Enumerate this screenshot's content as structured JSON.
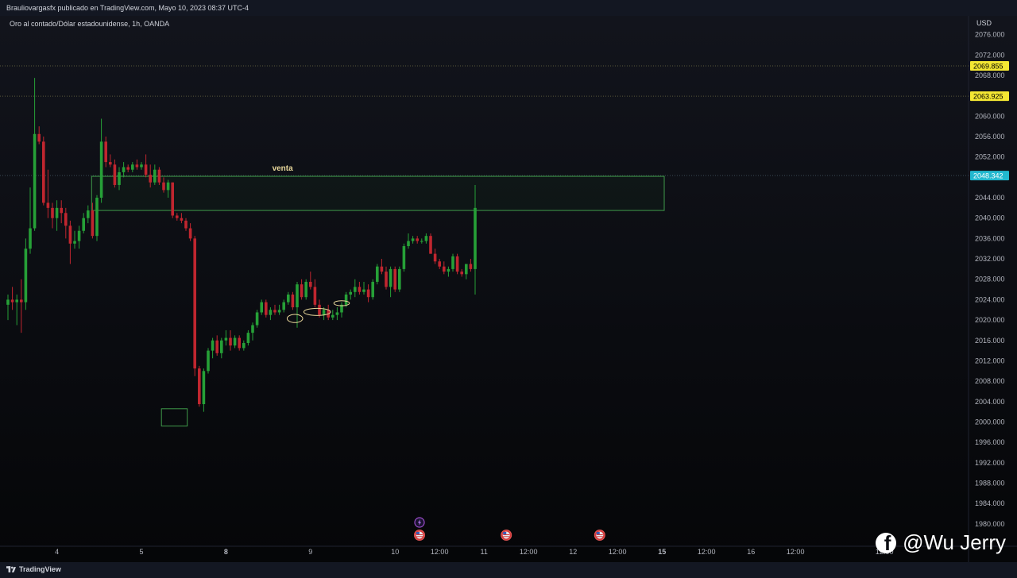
{
  "header": {
    "publisher_line": "Brauliovargasfx publicado en TradingView.com, Mayo 10, 2023 08:37 UTC-4",
    "symbol_line": "Oro al contado/Dólar estadounidense, 1h, OANDA"
  },
  "footer": {
    "brand": "TradingView"
  },
  "watermark": {
    "text": "@Wu Jerry",
    "icon": "facebook-icon"
  },
  "colors": {
    "background": "#0b0d12",
    "bull": "#26a037",
    "bear": "#c0262f",
    "zone": "#3f9a4a",
    "annotation": "#e8d79a",
    "price_tag_yellow": "#f4e733",
    "price_tag_cyan": "#22b8cf"
  },
  "chart_data": {
    "type": "candlestick",
    "title": "",
    "currency": "USD",
    "ylim": [
      1978,
      2080
    ],
    "y_ticks": [
      "2076.000",
      "2072.000",
      "2068.000",
      "2064.000",
      "2060.000",
      "2056.000",
      "2052.000",
      "2048.000",
      "2044.000",
      "2040.000",
      "2036.000",
      "2032.000",
      "2028.000",
      "2024.000",
      "2020.000",
      "2016.000",
      "2012.000",
      "2008.000",
      "2004.000",
      "2000.000",
      "1996.000",
      "1992.000",
      "1988.000",
      "1984.000",
      "1980.000"
    ],
    "x_labels": [
      {
        "label": "4",
        "bar": 11
      },
      {
        "label": "5",
        "bar": 30
      },
      {
        "label": "8",
        "bar": 49
      },
      {
        "label": "9",
        "bar": 68
      },
      {
        "label": "10",
        "bar": 87
      },
      {
        "label": "12:00",
        "bar": 97
      },
      {
        "label": "11",
        "bar": 107
      },
      {
        "label": "12:00",
        "bar": 117
      },
      {
        "label": "12",
        "bar": 127
      },
      {
        "label": "12:00",
        "bar": 137
      },
      {
        "label": "15",
        "bar": 147
      },
      {
        "label": "12:00",
        "bar": 157
      },
      {
        "label": "16",
        "bar": 167
      },
      {
        "label": "12:00",
        "bar": 177
      },
      {
        "label": "12:00",
        "bar": 197
      }
    ],
    "x_bold_labels": [
      "8",
      "15"
    ],
    "x_bar_count": 210,
    "candles": [
      [
        2023.0,
        2025.0,
        2020.0,
        2024.0
      ],
      [
        2024.0,
        2026.5,
        2022.0,
        2023.5
      ],
      [
        2023.5,
        2025.0,
        2019.0,
        2024.0
      ],
      [
        2024.0,
        2028.0,
        2017.5,
        2023.5
      ],
      [
        2023.5,
        2036.0,
        2022.0,
        2034.0
      ],
      [
        2034.0,
        2046.0,
        2033.0,
        2038.0
      ],
      [
        2038.0,
        2067.5,
        2037.5,
        2056.5
      ],
      [
        2056.5,
        2058.0,
        2054.5,
        2055.0
      ],
      [
        2055.0,
        2056.0,
        2042.5,
        2043.0
      ],
      [
        2043.0,
        2049.5,
        2040.0,
        2042.0
      ],
      [
        2042.0,
        2043.0,
        2038.0,
        2040.0
      ],
      [
        2040.0,
        2043.5,
        2037.5,
        2042.0
      ],
      [
        2042.0,
        2043.5,
        2039.0,
        2041.0
      ],
      [
        2041.0,
        2042.0,
        2036.0,
        2038.5
      ],
      [
        2038.5,
        2039.5,
        2031.0,
        2035.0
      ],
      [
        2035.0,
        2037.5,
        2034.0,
        2035.5
      ],
      [
        2035.5,
        2038.5,
        2034.0,
        2037.5
      ],
      [
        2037.5,
        2041.0,
        2037.0,
        2040.0
      ],
      [
        2040.0,
        2042.5,
        2039.0,
        2041.5
      ],
      [
        2041.5,
        2043.0,
        2036.0,
        2036.5
      ],
      [
        2036.5,
        2044.5,
        2035.5,
        2044.0
      ],
      [
        2044.0,
        2059.5,
        2043.0,
        2055.0
      ],
      [
        2055.0,
        2056.0,
        2050.0,
        2051.0
      ],
      [
        2051.0,
        2052.5,
        2050.0,
        2050.5
      ],
      [
        2050.5,
        2051.5,
        2046.0,
        2046.5
      ],
      [
        2046.5,
        2050.0,
        2045.5,
        2049.0
      ],
      [
        2049.0,
        2051.0,
        2048.0,
        2050.0
      ],
      [
        2050.0,
        2050.5,
        2049.0,
        2049.5
      ],
      [
        2049.5,
        2051.0,
        2049.0,
        2050.5
      ],
      [
        2050.5,
        2051.5,
        2049.5,
        2050.0
      ],
      [
        2050.0,
        2051.0,
        2049.5,
        2050.5
      ],
      [
        2050.5,
        2052.5,
        2048.0,
        2048.5
      ],
      [
        2048.5,
        2050.5,
        2046.0,
        2047.0
      ],
      [
        2047.0,
        2050.5,
        2046.5,
        2049.5
      ],
      [
        2049.5,
        2050.0,
        2046.5,
        2047.0
      ],
      [
        2047.0,
        2048.0,
        2045.0,
        2045.5
      ],
      [
        2045.5,
        2047.5,
        2044.0,
        2047.0
      ],
      [
        2047.0,
        2047.0,
        2040.0,
        2040.5
      ],
      [
        2040.5,
        2041.0,
        2039.5,
        2040.0
      ],
      [
        2040.0,
        2041.0,
        2039.0,
        2039.5
      ],
      [
        2039.5,
        2040.0,
        2037.5,
        2038.0
      ],
      [
        2038.0,
        2039.0,
        2035.5,
        2036.0
      ],
      [
        2036.0,
        2036.5,
        2009.0,
        2010.5
      ],
      [
        2010.5,
        2011.0,
        2003.0,
        2003.5
      ],
      [
        2003.5,
        2010.5,
        2002.0,
        2010.0
      ],
      [
        2010.0,
        2014.5,
        2009.5,
        2014.0
      ],
      [
        2014.0,
        2016.5,
        2012.5,
        2016.0
      ],
      [
        2016.0,
        2017.0,
        2013.0,
        2013.5
      ],
      [
        2013.5,
        2016.5,
        2012.5,
        2016.0
      ],
      [
        2016.0,
        2018.0,
        2015.0,
        2016.5
      ],
      [
        2016.5,
        2018.0,
        2014.0,
        2015.0
      ],
      [
        2015.0,
        2017.0,
        2014.5,
        2016.5
      ],
      [
        2016.5,
        2017.0,
        2014.0,
        2014.5
      ],
      [
        2014.5,
        2016.0,
        2014.0,
        2015.5
      ],
      [
        2015.5,
        2018.0,
        2015.0,
        2017.5
      ],
      [
        2017.5,
        2019.5,
        2016.0,
        2019.0
      ],
      [
        2019.0,
        2022.0,
        2018.5,
        2021.5
      ],
      [
        2021.5,
        2024.0,
        2021.0,
        2023.5
      ],
      [
        2023.5,
        2024.0,
        2020.5,
        2021.0
      ],
      [
        2021.0,
        2022.5,
        2020.0,
        2022.0
      ],
      [
        2022.0,
        2023.0,
        2021.0,
        2021.5
      ],
      [
        2021.5,
        2023.0,
        2021.0,
        2022.0
      ],
      [
        2022.0,
        2024.0,
        2021.5,
        2023.5
      ],
      [
        2023.5,
        2025.5,
        2023.0,
        2025.0
      ],
      [
        2025.0,
        2025.5,
        2022.0,
        2022.5
      ],
      [
        2022.5,
        2027.5,
        2018.5,
        2027.0
      ],
      [
        2027.0,
        2028.0,
        2024.0,
        2024.5
      ],
      [
        2024.5,
        2028.0,
        2024.0,
        2027.5
      ],
      [
        2027.5,
        2029.5,
        2026.0,
        2026.5
      ],
      [
        2026.5,
        2028.0,
        2022.5,
        2023.0
      ],
      [
        2023.0,
        2024.0,
        2020.5,
        2021.0
      ],
      [
        2021.0,
        2022.5,
        2020.0,
        2022.0
      ],
      [
        2022.0,
        2023.0,
        2020.0,
        2020.5
      ],
      [
        2020.5,
        2022.0,
        2020.0,
        2021.0
      ],
      [
        2021.0,
        2022.5,
        2020.0,
        2021.5
      ],
      [
        2021.5,
        2023.5,
        2020.5,
        2023.0
      ],
      [
        2023.0,
        2025.5,
        2022.5,
        2025.0
      ],
      [
        2025.0,
        2026.0,
        2024.0,
        2025.5
      ],
      [
        2025.5,
        2028.0,
        2024.5,
        2026.5
      ],
      [
        2026.5,
        2027.5,
        2025.0,
        2025.5
      ],
      [
        2025.5,
        2027.5,
        2025.0,
        2026.0
      ],
      [
        2026.0,
        2027.0,
        2023.5,
        2024.5
      ],
      [
        2024.5,
        2028.0,
        2024.0,
        2027.5
      ],
      [
        2027.5,
        2031.0,
        2027.0,
        2030.5
      ],
      [
        2030.5,
        2032.0,
        2029.0,
        2029.5
      ],
      [
        2029.5,
        2030.5,
        2026.0,
        2026.5
      ],
      [
        2026.5,
        2030.5,
        2024.5,
        2030.0
      ],
      [
        2030.0,
        2030.5,
        2025.5,
        2026.0
      ],
      [
        2026.0,
        2030.5,
        2025.5,
        2030.0
      ],
      [
        2030.0,
        2035.0,
        2029.5,
        2034.5
      ],
      [
        2034.5,
        2037.0,
        2034.0,
        2035.5
      ],
      [
        2035.5,
        2036.5,
        2035.0,
        2036.0
      ],
      [
        2036.0,
        2036.5,
        2035.0,
        2035.5
      ],
      [
        2035.5,
        2036.0,
        2035.0,
        2035.5
      ],
      [
        2035.5,
        2037.0,
        2035.0,
        2036.5
      ],
      [
        2036.5,
        2037.0,
        2033.0,
        2033.0
      ],
      [
        2033.0,
        2034.0,
        2031.0,
        2031.5
      ],
      [
        2031.5,
        2032.0,
        2030.0,
        2030.5
      ],
      [
        2030.5,
        2031.5,
        2029.0,
        2029.5
      ],
      [
        2029.5,
        2030.5,
        2028.5,
        2030.0
      ],
      [
        2030.0,
        2033.0,
        2029.5,
        2032.5
      ],
      [
        2032.5,
        2033.0,
        2029.0,
        2029.5
      ],
      [
        2029.5,
        2030.0,
        2028.5,
        2029.0
      ],
      [
        2029.0,
        2031.0,
        2028.0,
        2031.0
      ],
      [
        2031.0,
        2032.0,
        2029.5,
        2030.0
      ],
      [
        2030.0,
        2046.5,
        2025.0,
        2042.0
      ]
    ],
    "horizontal_lines": [
      {
        "price": 2069.855,
        "label": "2069.855",
        "tag_color": "yellow",
        "style": "dotted"
      },
      {
        "price": 2063.925,
        "label": "2063.925",
        "tag_color": "yellow",
        "style": "dotted"
      },
      {
        "price": 2048.342,
        "label": "2048.342",
        "tag_color": "cyan",
        "style": "dotted"
      }
    ],
    "zones": [
      {
        "name": "venta",
        "label": "venta",
        "price_top": 2048.2,
        "price_bottom": 2041.5,
        "bar_start": 18.8,
        "bar_end": 147.5
      }
    ],
    "marker_boxes": [
      {
        "price_top": 2002.6,
        "price_bottom": 1999.2,
        "bar_start": 34.5,
        "bar_end": 40.3
      }
    ],
    "ellipse_markers": [
      {
        "bar_center": 64.5,
        "price": 2020.3,
        "bar_width": 3.5,
        "price_height": 1.6
      },
      {
        "bar_center": 69.5,
        "price": 2021.6,
        "bar_width": 6.0,
        "price_height": 1.4
      },
      {
        "bar_center": 75.0,
        "price": 2023.3,
        "bar_width": 3.5,
        "price_height": 1.0
      }
    ],
    "event_icons": [
      {
        "bar": 92.5,
        "row": 1,
        "kind": "lightning-icon"
      },
      {
        "bar": 92.5,
        "row": 2,
        "kind": "us-flag-icon"
      },
      {
        "bar": 112.0,
        "row": 2,
        "kind": "us-flag-icon"
      },
      {
        "bar": 133.0,
        "row": 2,
        "kind": "us-flag-icon"
      }
    ]
  }
}
